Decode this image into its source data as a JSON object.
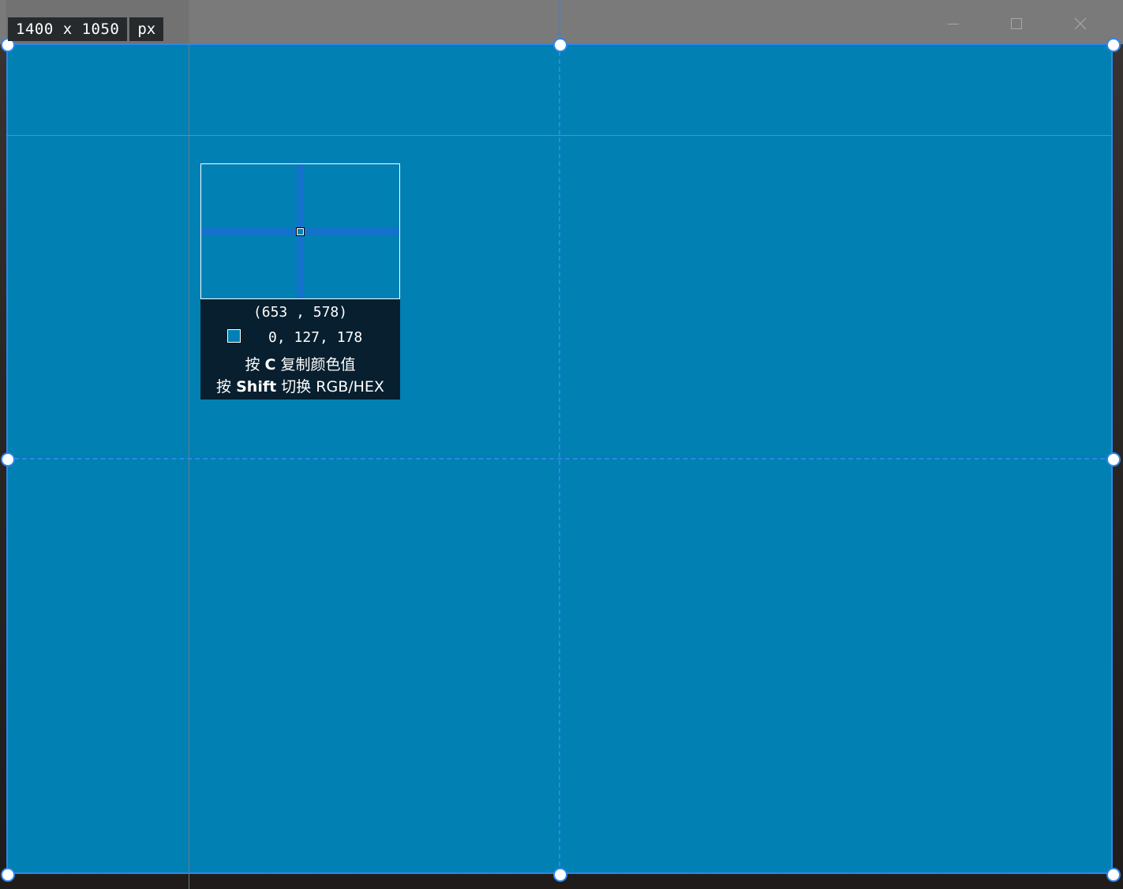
{
  "selection_size": {
    "dimensions": "1400 x 1050",
    "unit": "px"
  },
  "magnifier": {
    "coordinates": "(653 , 578)",
    "color_value": "0, 127, 178",
    "swatch_color": "#0080b3",
    "hint_copy": {
      "prefix": "按",
      "key": "C",
      "suffix": "复制颜色值"
    },
    "hint_toggle": {
      "prefix": "按",
      "key": "Shift",
      "suffix": "切换 RGB/HEX"
    }
  },
  "colors": {
    "selection_fill": "#0080b3",
    "guide": "#2f86e8",
    "info_bg": "#071f2e"
  },
  "icons": {
    "minimize": "minimize-icon",
    "maximize": "maximize-icon",
    "close": "close-icon"
  }
}
